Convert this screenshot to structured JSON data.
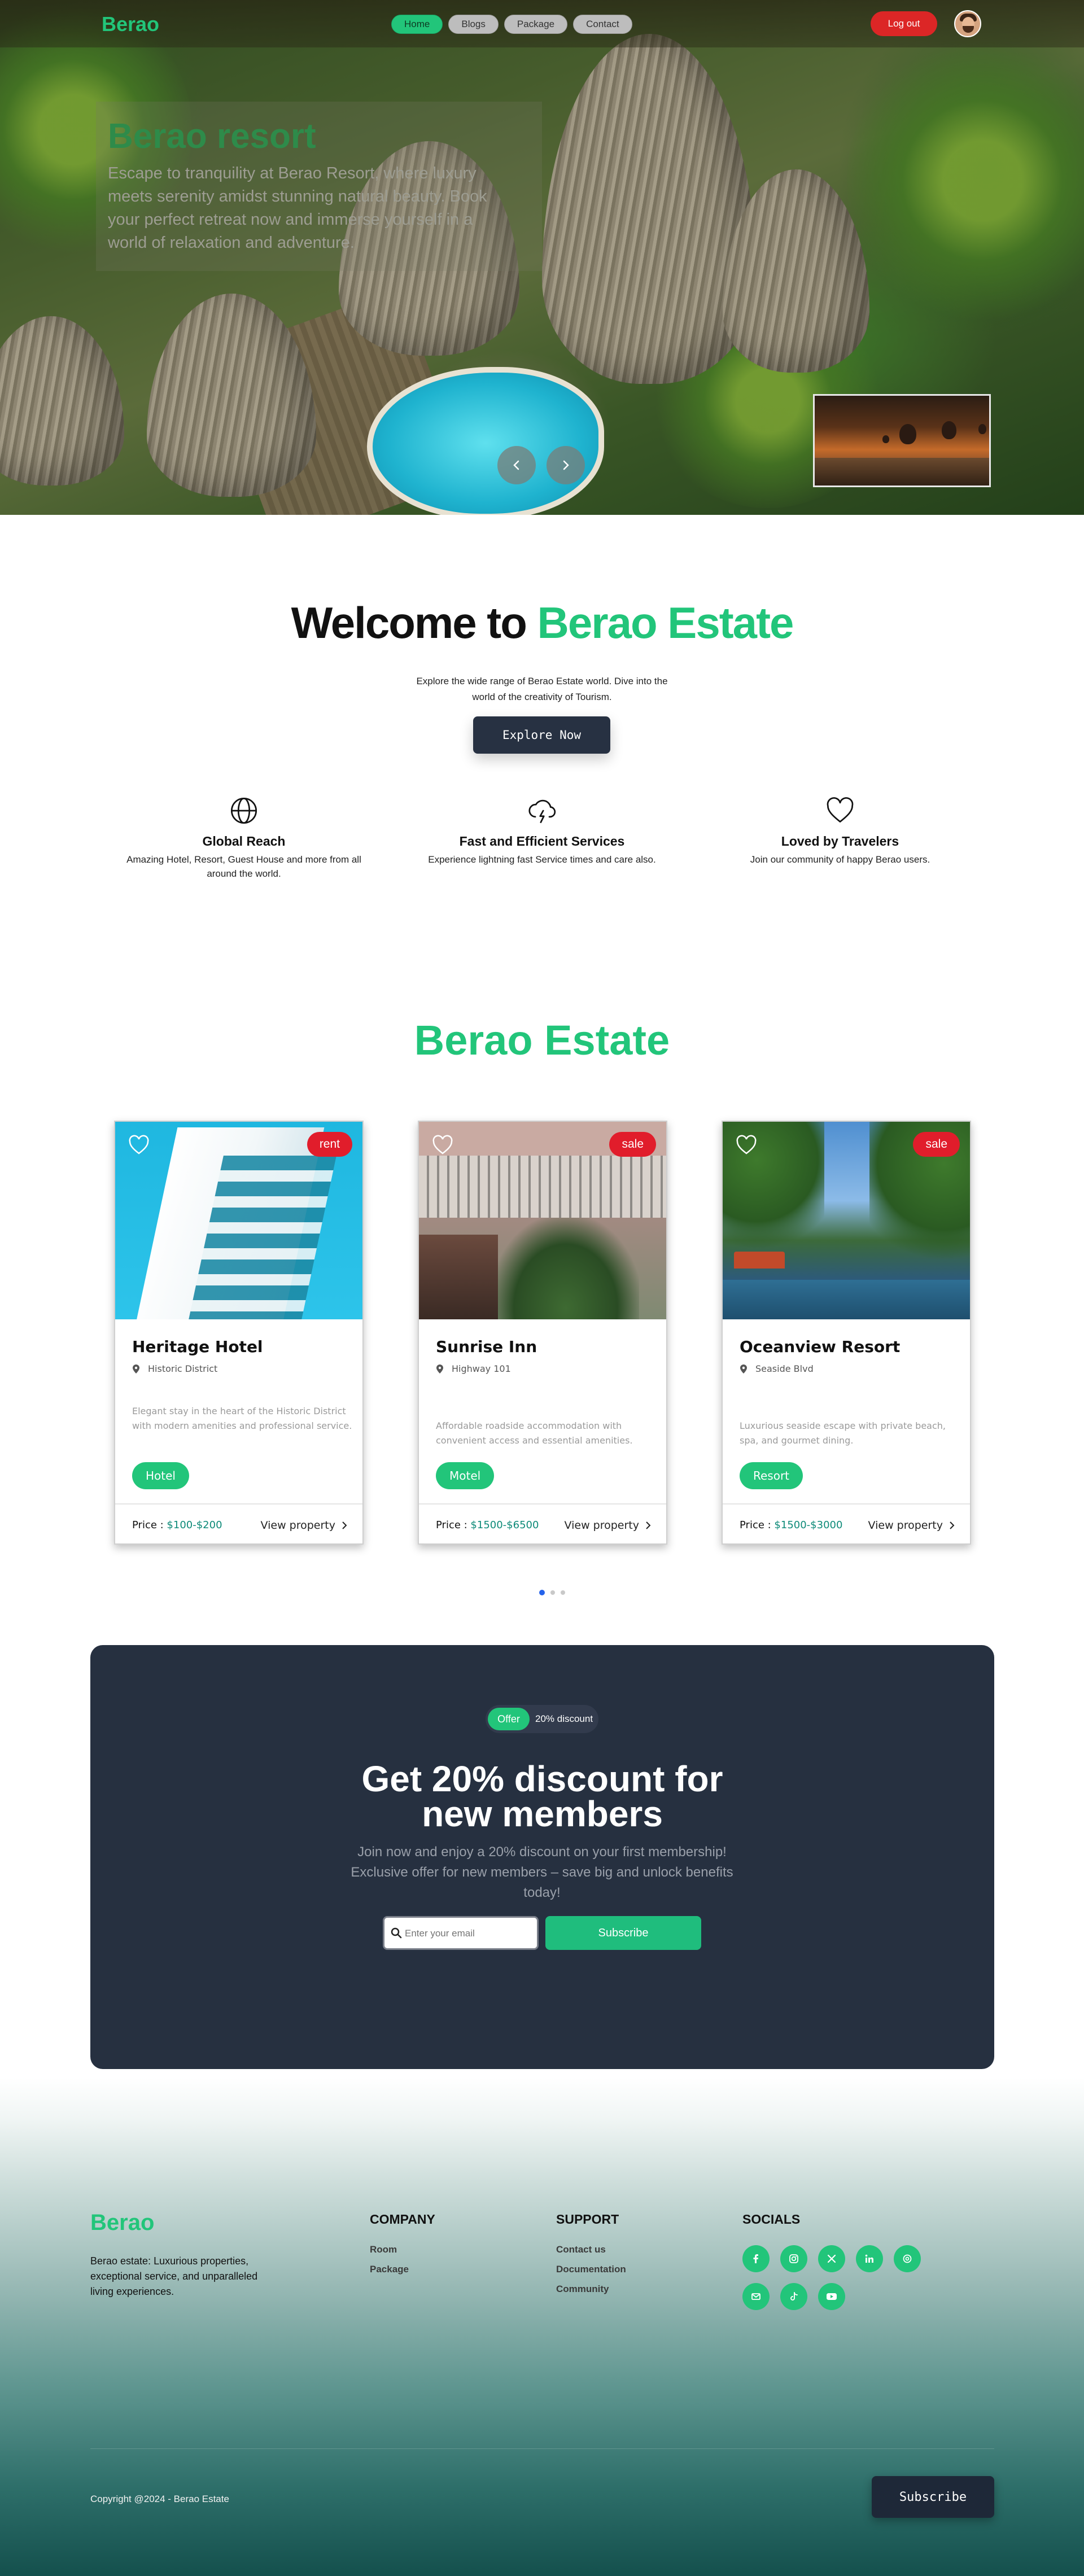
{
  "nav": {
    "logo": "Berao",
    "links": [
      "Home",
      "Blogs",
      "Package",
      "Contact"
    ],
    "active": "Home",
    "logout_label": "Log out"
  },
  "hero": {
    "title": "Berao resort",
    "description": "Escape to tranquility at Berao Resort, where luxury meets serenity amidst stunning natural beauty. Book your perfect retreat now and immerse yourself in a world of relaxation and adventure.",
    "prev_icon": "chevron-left-icon",
    "next_icon": "chevron-right-icon"
  },
  "welcome": {
    "title_prefix": "Welcome to ",
    "title_highlight": "Berao Estate",
    "subtitle": "Explore the wide range of Berao Estate world. Dive into the world of the creativity of Tourism.",
    "button_label": "Explore Now",
    "features": [
      {
        "icon": "globe-icon",
        "title": "Global Reach",
        "desc": "Amazing Hotel, Resort, Guest House and more from all around the world."
      },
      {
        "icon": "lightning-cloud-icon",
        "title": "Fast and Efficient Services",
        "desc": "Experience lightning fast Service times and care also."
      },
      {
        "icon": "heart-icon",
        "title": "Loved by Travelers",
        "desc": "Join our community of happy Berao users."
      }
    ]
  },
  "estate": {
    "title": "Berao Estate",
    "cards": [
      {
        "name": "Heritage Hotel",
        "tag": "rent",
        "location": "Historic District",
        "description": "Elegant stay in the heart of the Historic District with modern amenities and professional service.",
        "type": "Hotel",
        "price_label": "Price : ",
        "price": "$100-$200",
        "view_label": "View property"
      },
      {
        "name": "Sunrise Inn",
        "tag": "sale",
        "location": "Highway 101",
        "description": "Affordable roadside accommodation with convenient access and essential amenities.",
        "type": "Motel",
        "price_label": "Price : ",
        "price": "$1500-$6500",
        "view_label": "View property"
      },
      {
        "name": "Oceanview Resort",
        "tag": "sale",
        "location": "Seaside Blvd",
        "description": "Luxurious seaside escape with private beach, spa, and gourmet dining.",
        "type": "Resort",
        "price_label": "Price : ",
        "price": "$1500-$3000",
        "view_label": "View property"
      }
    ],
    "pagination": {
      "pages": 3,
      "current": 1
    }
  },
  "offer": {
    "badge_pill": "Offer",
    "badge_text": "20% discount",
    "title_line1": "Get 20% discount for",
    "title_line2": "new members",
    "description": "Join now and enjoy a 20% discount on your first membership! Exclusive offer for new members – save big and unlock benefits today!",
    "email_placeholder": "Enter your email",
    "button_label": "Subscribe"
  },
  "footer": {
    "logo": "Berao",
    "about": "Berao estate: Luxurious properties, exceptional service, and unparalleled living experiences.",
    "company": {
      "heading": "COMPANY",
      "links": [
        "Room",
        "Package"
      ]
    },
    "support": {
      "heading": "SUPPORT",
      "links": [
        "Contact us",
        "Documentation",
        "Community"
      ]
    },
    "socials": {
      "heading": "SOCIALS",
      "icons": [
        "facebook-icon",
        "instagram-icon",
        "x-icon",
        "linkedin-icon",
        "threads-icon",
        "mail-icon",
        "tiktok-icon",
        "youtube-icon"
      ]
    },
    "copyright": "Copyright @2024 - Berao Estate",
    "subscribe_label": "Subscribe"
  },
  "colors": {
    "brand_green": "#22c57a",
    "dark_navy": "#263040",
    "tag_red": "#e11d2b",
    "logout_red": "#dc2626",
    "price_teal": "#0d8a78"
  }
}
